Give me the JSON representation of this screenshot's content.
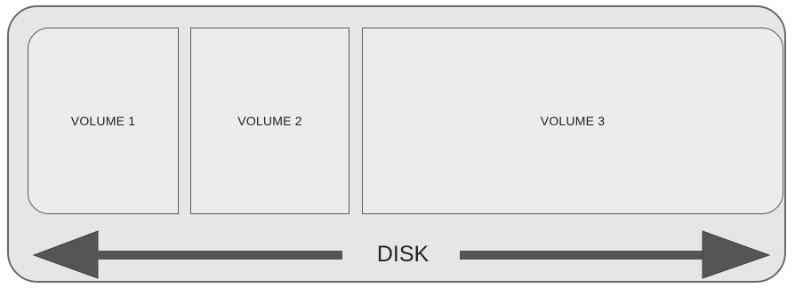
{
  "disk": {
    "label": "DISK"
  },
  "volumes": [
    {
      "label": "VOLUME 1"
    },
    {
      "label": "VOLUME 2"
    },
    {
      "label": "VOLUME 3"
    }
  ],
  "colors": {
    "disk_fill": "#e6e6e6",
    "volume_fill": "#ececec",
    "border": "#5a5a5a",
    "arrow": "#555555"
  }
}
